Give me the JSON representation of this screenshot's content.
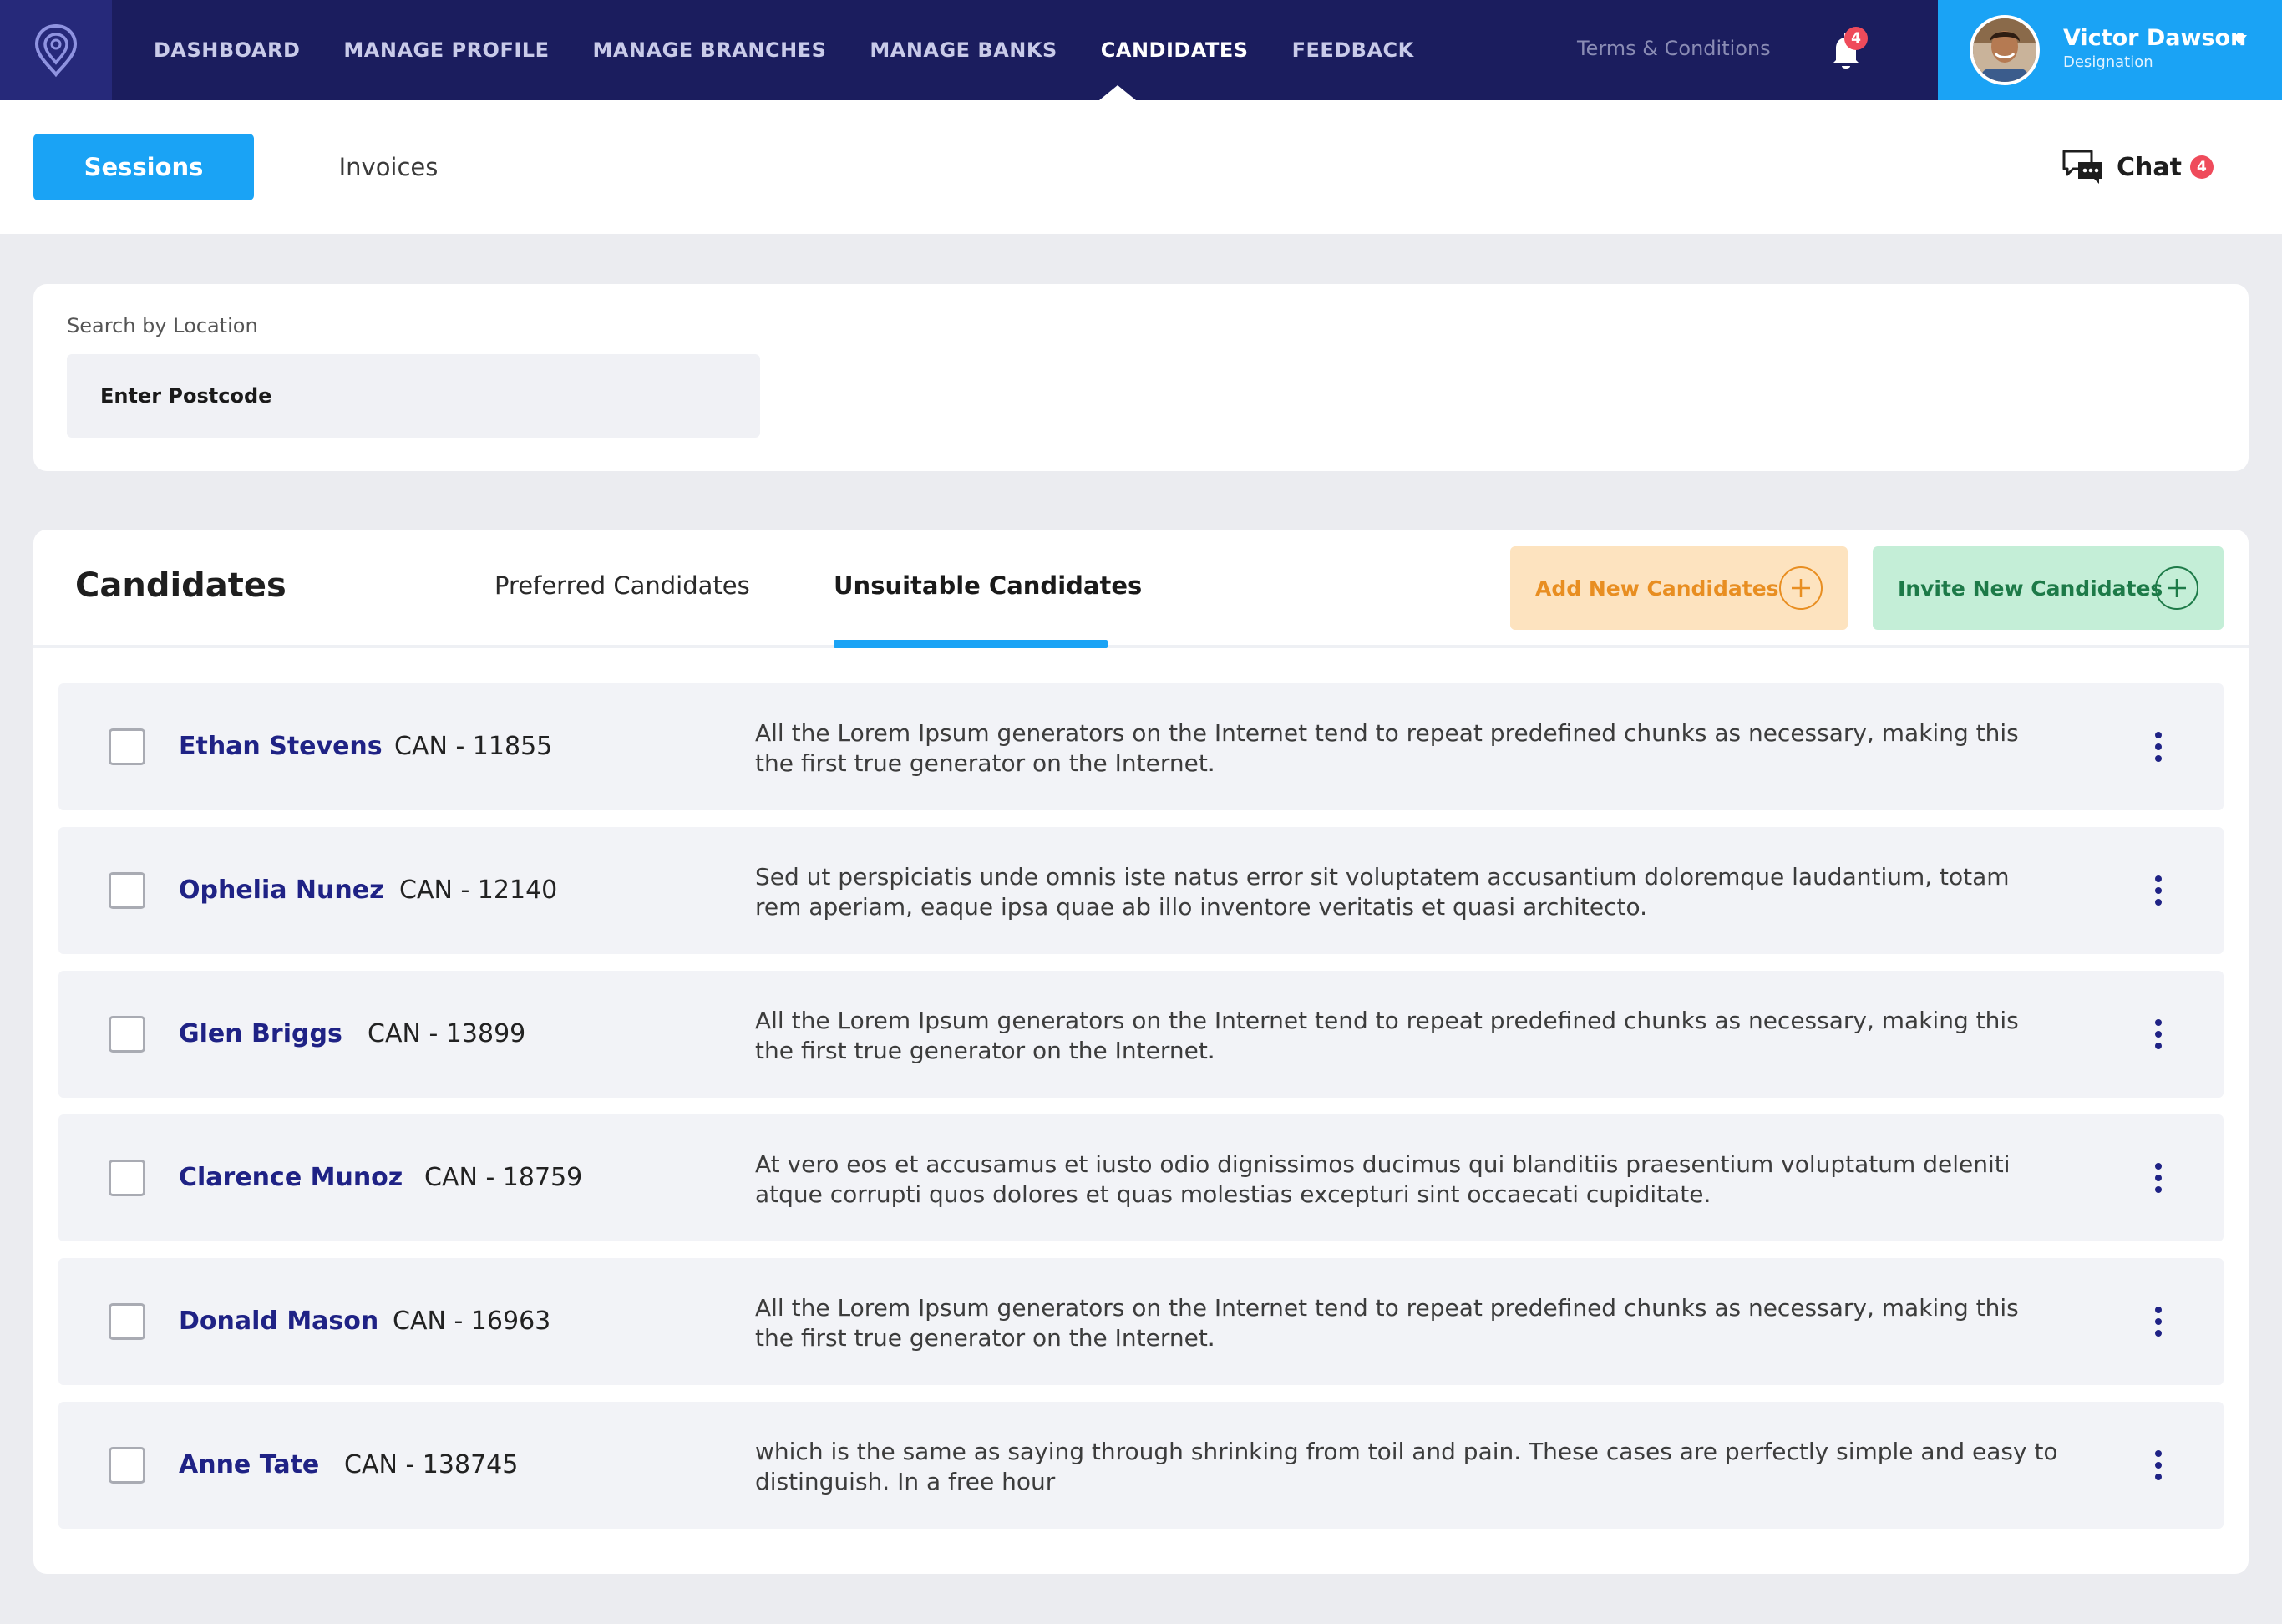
{
  "nav": {
    "items": [
      {
        "label": "DASHBOARD"
      },
      {
        "label": "MANAGE PROFILE"
      },
      {
        "label": "MANAGE BRANCHES"
      },
      {
        "label": "MANAGE BANKS"
      },
      {
        "label": "CANDIDATES"
      },
      {
        "label": "FEEDBACK"
      }
    ],
    "active_index": 4,
    "terms_label": "Terms & Conditions",
    "notifications_count": "4"
  },
  "user": {
    "name": "Victor Dawson",
    "role": "Designation"
  },
  "subbar": {
    "sessions_label": "Sessions",
    "invoices_label": "Invoices",
    "chat_label": "Chat",
    "chat_count": "4"
  },
  "search": {
    "label": "Search by Location",
    "placeholder": "Enter Postcode"
  },
  "candidates": {
    "title": "Candidates",
    "tabs": [
      {
        "label": "Preferred Candidates"
      },
      {
        "label": "Unsuitable Candidates"
      }
    ],
    "active_tab": 1,
    "add_label": "Add New Candidates",
    "invite_label": "Invite New Candidates",
    "rows": [
      {
        "name": "Ethan Stevens",
        "id": "CAN - 11855",
        "description": "All the Lorem Ipsum generators on the Internet tend to repeat predefined chunks as necessary, making this the first true generator on the Internet."
      },
      {
        "name": "Ophelia Nunez",
        "id": "CAN - 12140",
        "description": "Sed ut perspiciatis unde omnis iste natus error sit voluptatem accusantium doloremque laudantium, totam rem aperiam, eaque ipsa quae ab illo inventore veritatis et quasi architecto."
      },
      {
        "name": "Glen Briggs",
        "id": "CAN - 13899",
        "description": "All the Lorem Ipsum generators on the Internet tend to repeat predefined chunks as necessary, making this the first true generator on the Internet."
      },
      {
        "name": "Clarence Munoz",
        "id": "CAN - 18759",
        "description": "At vero eos et accusamus et iusto odio dignissimos ducimus qui blanditiis praesentium voluptatum deleniti atque corrupti quos dolores et quas molestias excepturi sint occaecati cupiditate."
      },
      {
        "name": "Donald Mason",
        "id": "CAN - 16963",
        "description": "All the Lorem Ipsum generators on the Internet tend to repeat predefined chunks as necessary, making this the first true generator on the Internet."
      },
      {
        "name": "Anne Tate",
        "id": "CAN - 138745",
        "description": "which is the same as saying through shrinking from toil and pain. These cases are perfectly simple and easy to distinguish. In a free hour"
      }
    ]
  },
  "colors": {
    "nav_bg": "#1b1d5e",
    "accent_blue": "#1aa3f5",
    "badge_red": "#ef4b5b",
    "add_bg": "#fde3bf",
    "add_fg": "#e88e21",
    "invite_bg": "#c4eed7",
    "invite_fg": "#1d7a48",
    "candidate_name": "#1f2285"
  },
  "icons": {
    "logo": "location-pin-logo-icon",
    "bell": "bell-icon",
    "chat": "chat-bubbles-icon",
    "user_dropdown": "chevron-down-icon",
    "add": "plus-circle-icon",
    "row_menu": "kebab-menu-icon"
  }
}
